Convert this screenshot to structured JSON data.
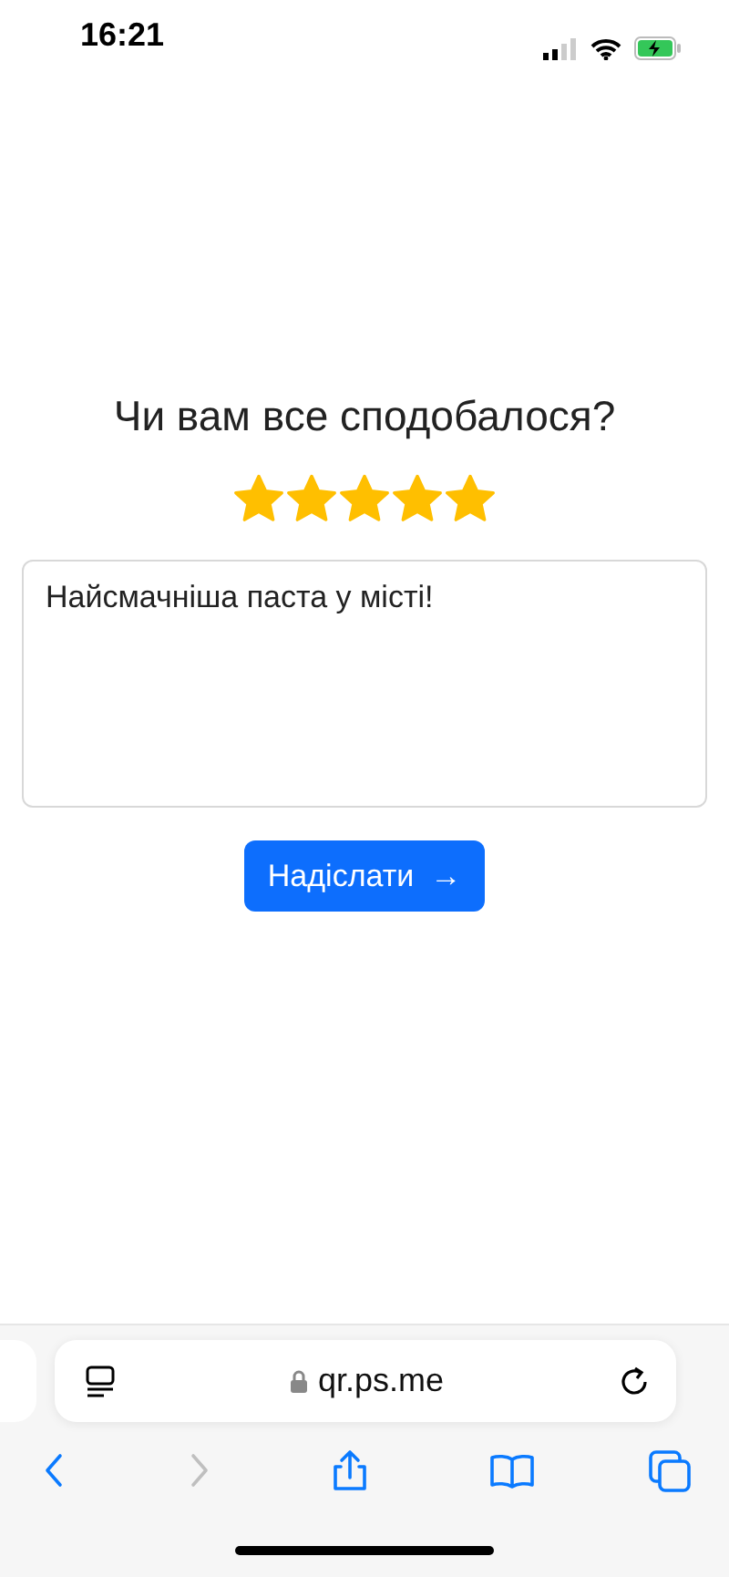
{
  "status_bar": {
    "time": "16:21"
  },
  "feedback": {
    "title": "Чи вам все сподобалося?",
    "stars": 5,
    "review": {
      "value": "Найсмачніша паста у місті!"
    },
    "submit_button": {
      "label": "Надіслати",
      "icon": "→"
    }
  },
  "browser": {
    "address": "qr.ps.me",
    "toolbar": [
      {
        "kind": "back",
        "disabled": false
      },
      {
        "kind": "forward",
        "disabled": true
      },
      {
        "kind": "share",
        "disabled": false
      },
      {
        "kind": "bookmarks",
        "disabled": false
      },
      {
        "kind": "tabs",
        "disabled": false
      }
    ]
  }
}
